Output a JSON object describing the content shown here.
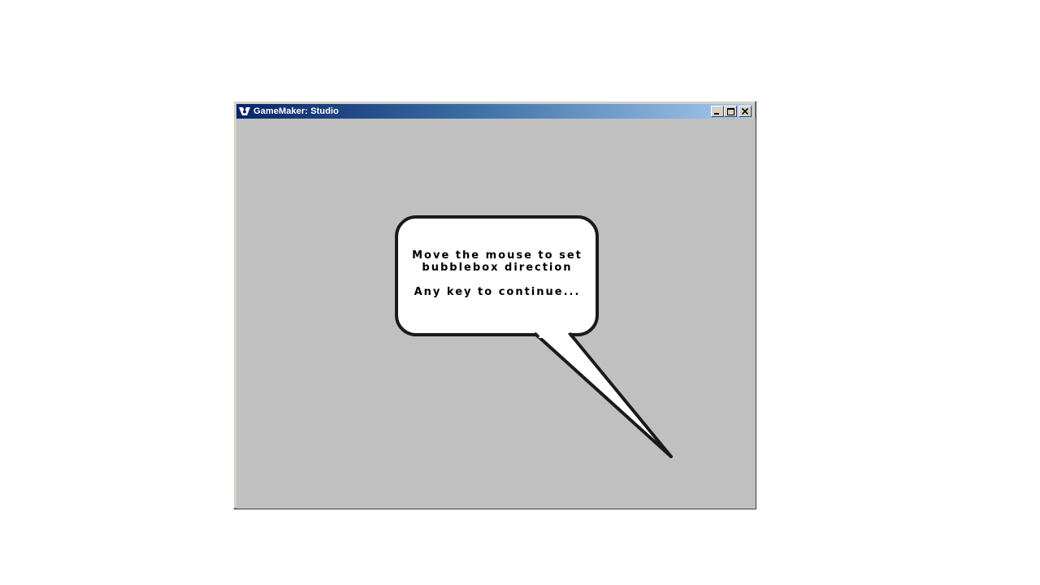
{
  "window": {
    "title": "GameMaker: Studio",
    "controls": {
      "minimize": "minimize",
      "maximize": "maximize",
      "close": "close"
    }
  },
  "bubble": {
    "line1": "Move the mouse to set",
    "line2": "bubblebox direction",
    "line3": "Any key to continue..."
  },
  "colors": {
    "client_background": "#c0c0c0",
    "bubble_fill": "#ffffff",
    "bubble_outline": "#1a1a1a",
    "titlebar_start": "#0a246a",
    "titlebar_end": "#a6caf0"
  },
  "icons": {
    "app": "gamemaker-logo-icon",
    "minimize": "minimize-icon",
    "maximize": "maximize-icon",
    "close": "close-icon"
  }
}
